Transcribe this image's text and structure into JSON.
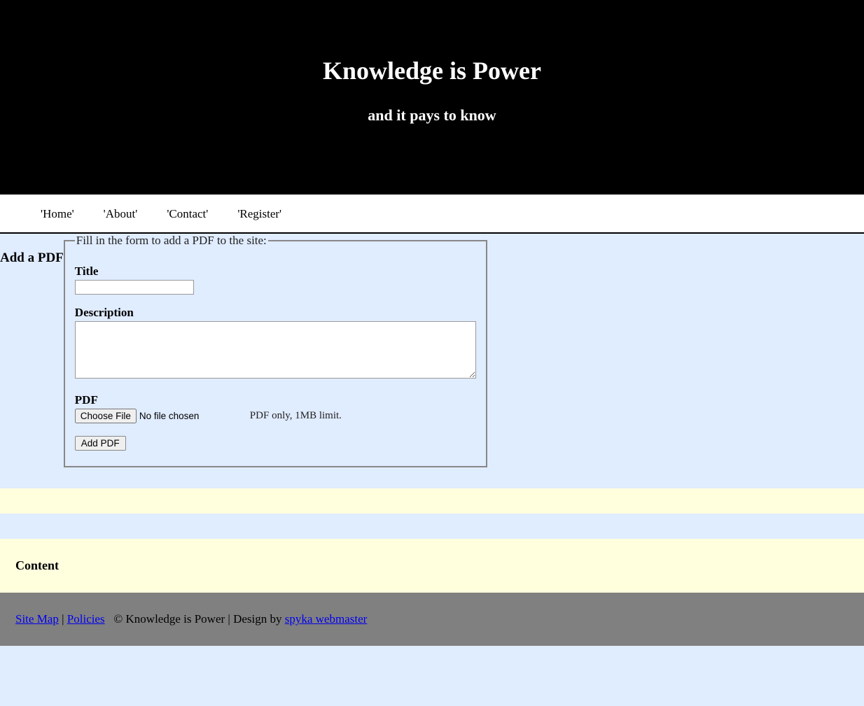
{
  "header": {
    "title": "Knowledge is Power",
    "subtitle": "and it pays to know"
  },
  "nav": {
    "items": [
      "'Home'",
      "'About'",
      "'Contact'",
      "'Register'"
    ]
  },
  "main": {
    "heading": "Add a PDF",
    "legend": "Fill in the form to add a PDF to the site:",
    "fields": {
      "title_label": "Title",
      "title_value": "",
      "description_label": "Description",
      "description_value": "",
      "pdf_label": "PDF",
      "file_button": "Choose File",
      "file_status": "No file chosen",
      "file_note": "PDF only, 1MB limit."
    },
    "submit_label": "Add PDF"
  },
  "sidebar": {
    "content_heading": "Content"
  },
  "footer": {
    "sitemap": "Site Map",
    "policies": "Policies",
    "separator": " | ",
    "copyright": "© Knowledge is Power | Design by ",
    "design_link": "spyka webmaster"
  }
}
